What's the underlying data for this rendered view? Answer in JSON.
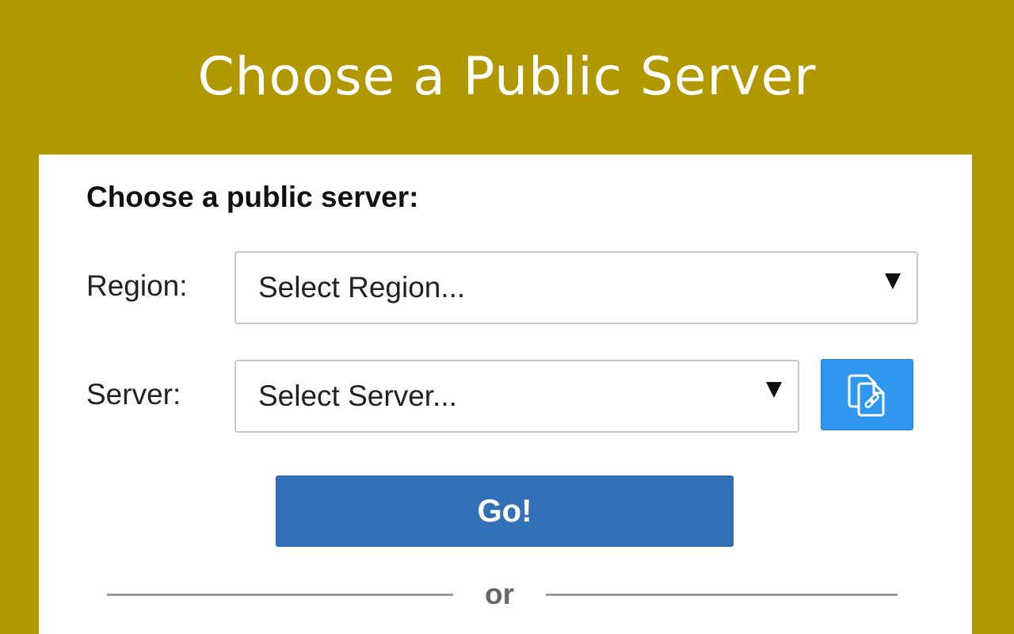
{
  "page": {
    "title": "Choose a Public Server",
    "background_color": "#b19800"
  },
  "form": {
    "heading": "Choose a public server:",
    "region": {
      "label": "Region:",
      "selected": "Select Region..."
    },
    "server": {
      "label": "Server:",
      "selected": "Select Server..."
    },
    "copy_link_icon": "copy-link-icon",
    "go_label": "Go!",
    "divider_text": "or"
  },
  "colors": {
    "accent_blue": "#3271b8",
    "icon_button_blue": "#2f97ef"
  }
}
